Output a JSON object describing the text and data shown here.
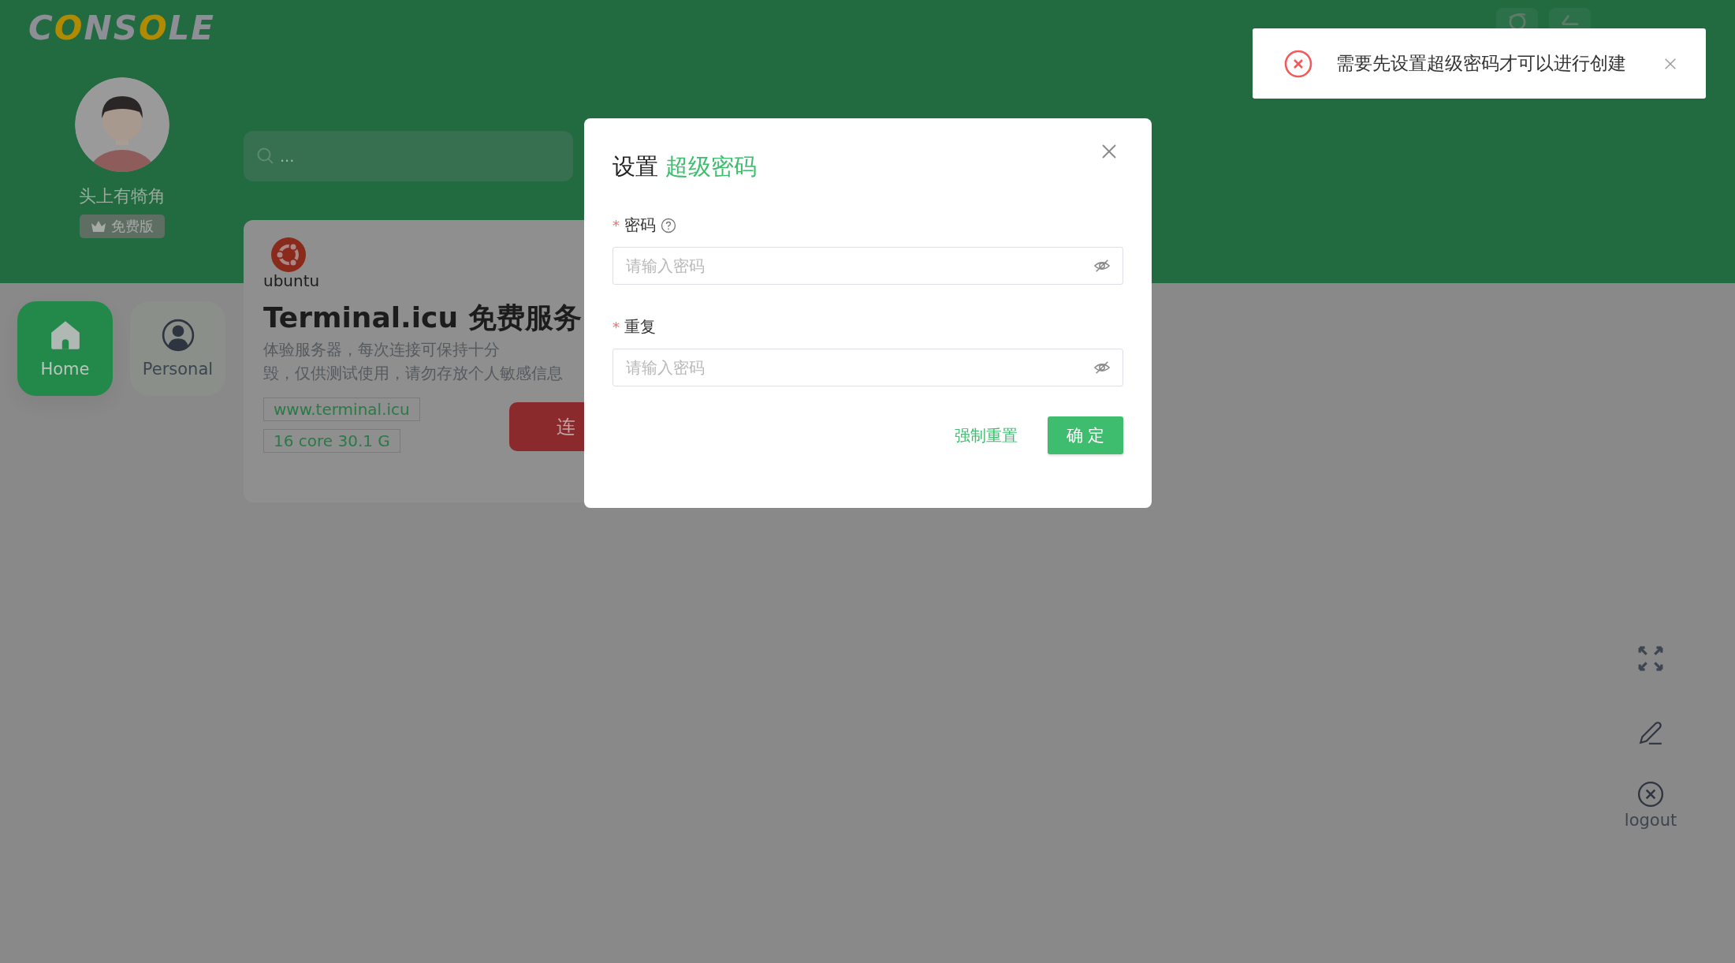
{
  "header": {
    "logo_parts": [
      {
        "text": "C",
        "accent": false
      },
      {
        "text": "O",
        "accent": true
      },
      {
        "text": "NS",
        "accent": false
      },
      {
        "text": "O",
        "accent": true
      },
      {
        "text": "LE",
        "accent": false
      }
    ]
  },
  "user": {
    "name": "头上有犄角",
    "plan": "免费版"
  },
  "nav": [
    {
      "kind": "home",
      "label": "Home",
      "selected": true
    },
    {
      "kind": "personal",
      "label": "Personal",
      "selected": false
    }
  ],
  "search": {
    "placeholder": "..."
  },
  "server_card": {
    "os_name": "ubuntu",
    "title": "Terminal.icu 免费服务",
    "description_lines": [
      "体验服务器，每次连接可保持十分",
      "毁，仅供测试使用，请勿存放个人敏感信息"
    ],
    "tags": [
      "www.terminal.icu",
      "16 core 30.1 G"
    ],
    "connect_button": "连"
  },
  "side_tools": {
    "logout": "logout"
  },
  "dialog": {
    "title": "设置",
    "title_highlight": "超级密码",
    "fields": [
      {
        "label": "密码",
        "required_mark": "*",
        "help": true,
        "placeholder": "请输入密码"
      },
      {
        "label": "重复",
        "required_mark": "*",
        "help": false,
        "placeholder": "请输入密码"
      }
    ],
    "secondary_button": "强制重置",
    "primary_button": "确 定"
  },
  "toast": {
    "kind": "error",
    "message": "需要先设置超级密码才可以进行创建"
  }
}
